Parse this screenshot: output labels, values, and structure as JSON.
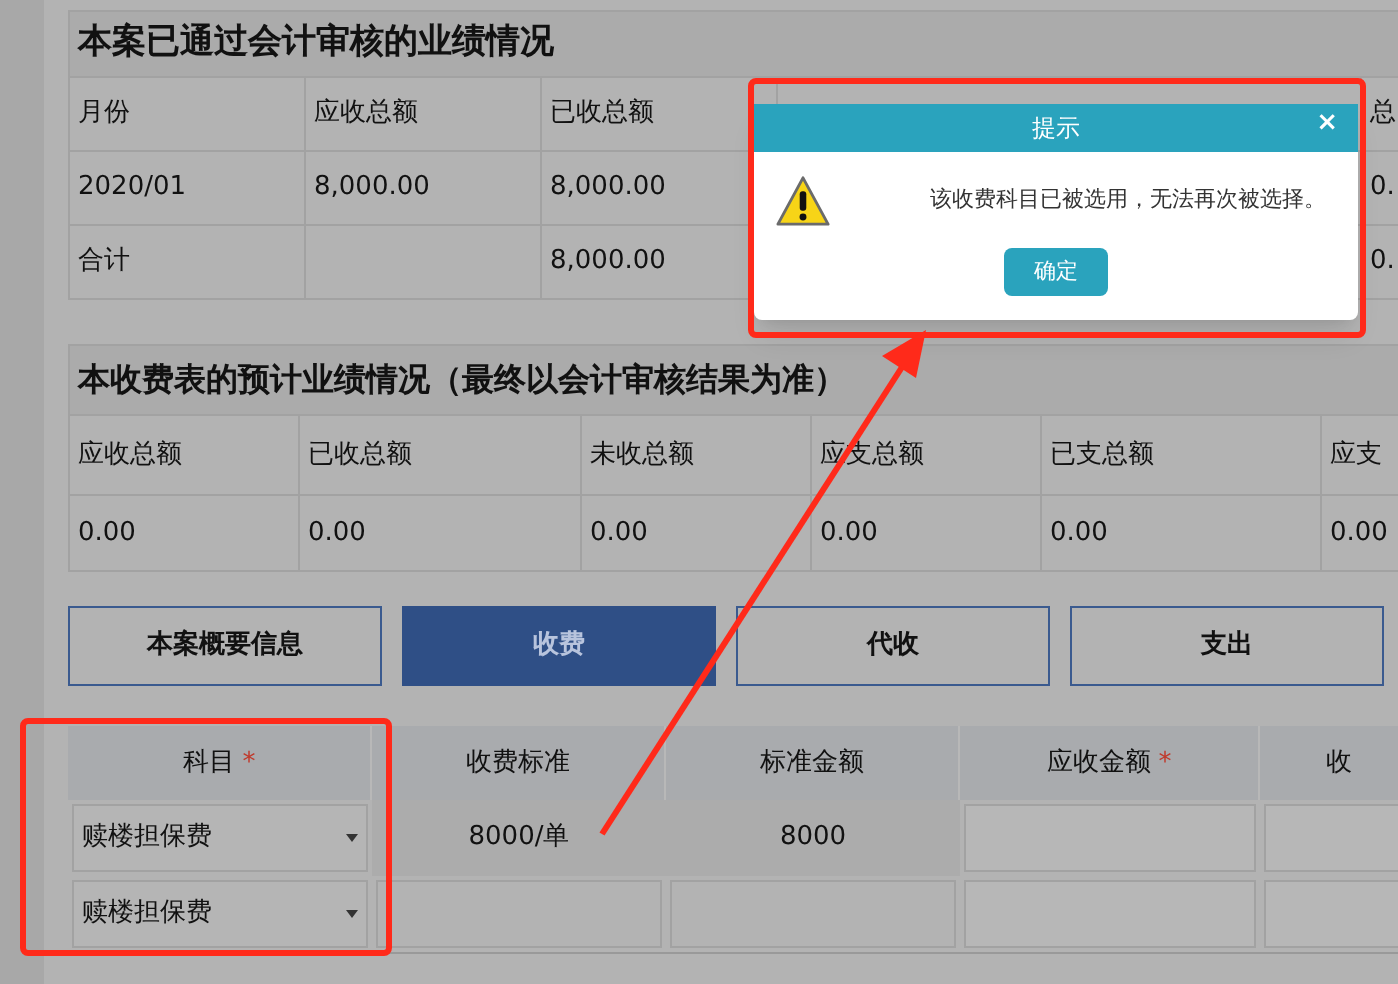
{
  "audited_table": {
    "title": "本案已通过会计审核的业绩情况",
    "columns": [
      "月份",
      "应收总额",
      "已收总额",
      "总"
    ],
    "rows": [
      {
        "cells": [
          "2020/01",
          "8,000.00",
          "8,000.00",
          "0."
        ]
      },
      {
        "cells": [
          "合计",
          null,
          "8,000.00",
          "0."
        ]
      }
    ]
  },
  "forecast_table": {
    "title": "本收费表的预计业绩情况（最终以会计审核结果为准）",
    "columns": [
      "应收总额",
      "已收总额",
      "未收总额",
      "应支总额",
      "已支总额",
      "应支"
    ],
    "values": [
      "0.00",
      "0.00",
      "0.00",
      "0.00",
      "0.00",
      "0.00"
    ]
  },
  "tabs": [
    {
      "label": "本案概要信息",
      "selected": false
    },
    {
      "label": "收费",
      "selected": true
    },
    {
      "label": "代收",
      "selected": false
    },
    {
      "label": "支出",
      "selected": false
    }
  ],
  "fee_table": {
    "required_mark": "*",
    "columns": [
      {
        "label": "科目",
        "required": true
      },
      {
        "label": "收费标准",
        "required": false
      },
      {
        "label": "标准金额",
        "required": false
      },
      {
        "label": "应收金额",
        "required": true
      },
      {
        "label": "收",
        "required": false
      }
    ],
    "rows": [
      {
        "subject": "赎楼担保费",
        "standard": "8000/单",
        "amount": "8000"
      },
      {
        "subject": "赎楼担保费",
        "standard": null,
        "amount": null
      }
    ]
  },
  "dialog": {
    "title": "提示",
    "close": "×",
    "message": "该收费科目已被选用，无法再次被选择。",
    "button": "确定"
  }
}
